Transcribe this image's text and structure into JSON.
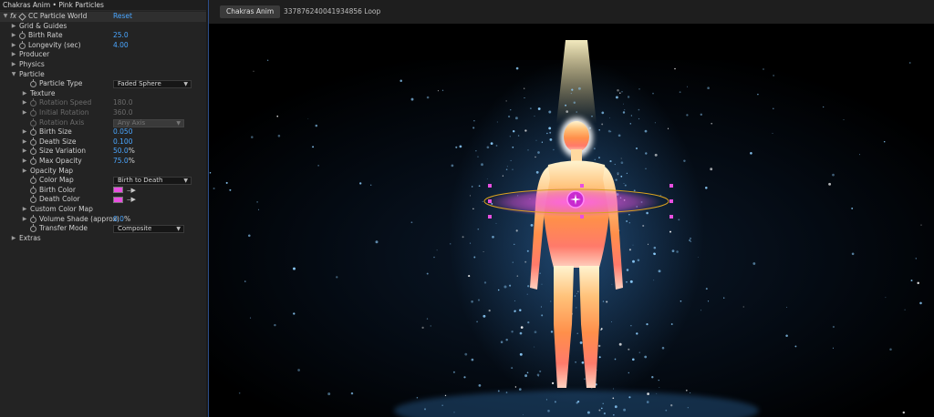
{
  "effects": {
    "title": "Chakras Anim • Pink Particles",
    "effect_name": "CC Particle World",
    "fx_label": "fx",
    "reset_label": "Reset",
    "rows": [
      {
        "label": "Grid & Guides"
      },
      {
        "label": "Birth Rate",
        "value": "25.0"
      },
      {
        "label": "Longevity (sec)",
        "value": "4.00"
      },
      {
        "label": "Producer"
      },
      {
        "label": "Physics"
      },
      {
        "label": "Particle"
      },
      {
        "label": "Particle Type",
        "value": "Faded Sphere"
      },
      {
        "label": "Texture"
      },
      {
        "label": "Rotation Speed",
        "value": "180.0"
      },
      {
        "label": "Initial Rotation",
        "value": "360.0"
      },
      {
        "label": "Rotation Axis",
        "value": "Any Axis"
      },
      {
        "label": "Birth Size",
        "value": "0.050"
      },
      {
        "label": "Death Size",
        "value": "0.100"
      },
      {
        "label": "Size Variation",
        "value": "50.0",
        "suffix": "%"
      },
      {
        "label": "Max Opacity",
        "value": "75.0",
        "suffix": "%"
      },
      {
        "label": "Opacity Map"
      },
      {
        "label": "Color Map",
        "value": "Birth to Death"
      },
      {
        "label": "Birth Color",
        "color": "#e84fe0"
      },
      {
        "label": "Death Color",
        "color": "#e84fe0"
      },
      {
        "label": "Custom Color Map"
      },
      {
        "label": "Volume Shade (approx)",
        "value": "0.0",
        "suffix": "%"
      },
      {
        "label": "Transfer Mode",
        "value": "Composite"
      },
      {
        "label": "Extras"
      }
    ]
  },
  "composition": {
    "tab_active": "Chakras Anim",
    "tab_inactive": "337876240041934856 Loop"
  },
  "colors": {
    "accent_blue": "#4aa6ff",
    "particle_pink": "#e84fe0",
    "body_glow": "#ff8a3c"
  }
}
